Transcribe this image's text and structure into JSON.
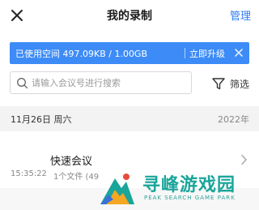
{
  "header": {
    "title": "我的录制",
    "manage_label": "管理"
  },
  "storage": {
    "text": "已使用空间 497.09KB / 1.00GB",
    "upgrade_label": "立即升级"
  },
  "search": {
    "placeholder": "请输入会议号进行搜索",
    "value": ""
  },
  "filter": {
    "label": "筛选"
  },
  "date_group": {
    "date": "11月26日 周六",
    "year": "2022年"
  },
  "records": [
    {
      "title": "快速会议",
      "time": "15:35:22",
      "files": "1个文件 (49"
    }
  ],
  "watermark": {
    "text": "寻峰游戏园",
    "subtext": "PEAK SEARCH GAME PARK"
  },
  "colors": {
    "accent": "#2f7cf6",
    "storage_bar": "#3d8bf7",
    "watermark": "#1aa59a"
  },
  "icons": [
    "close-icon",
    "search-icon",
    "filter-icon",
    "chevron-right-icon",
    "bar-close-icon"
  ]
}
